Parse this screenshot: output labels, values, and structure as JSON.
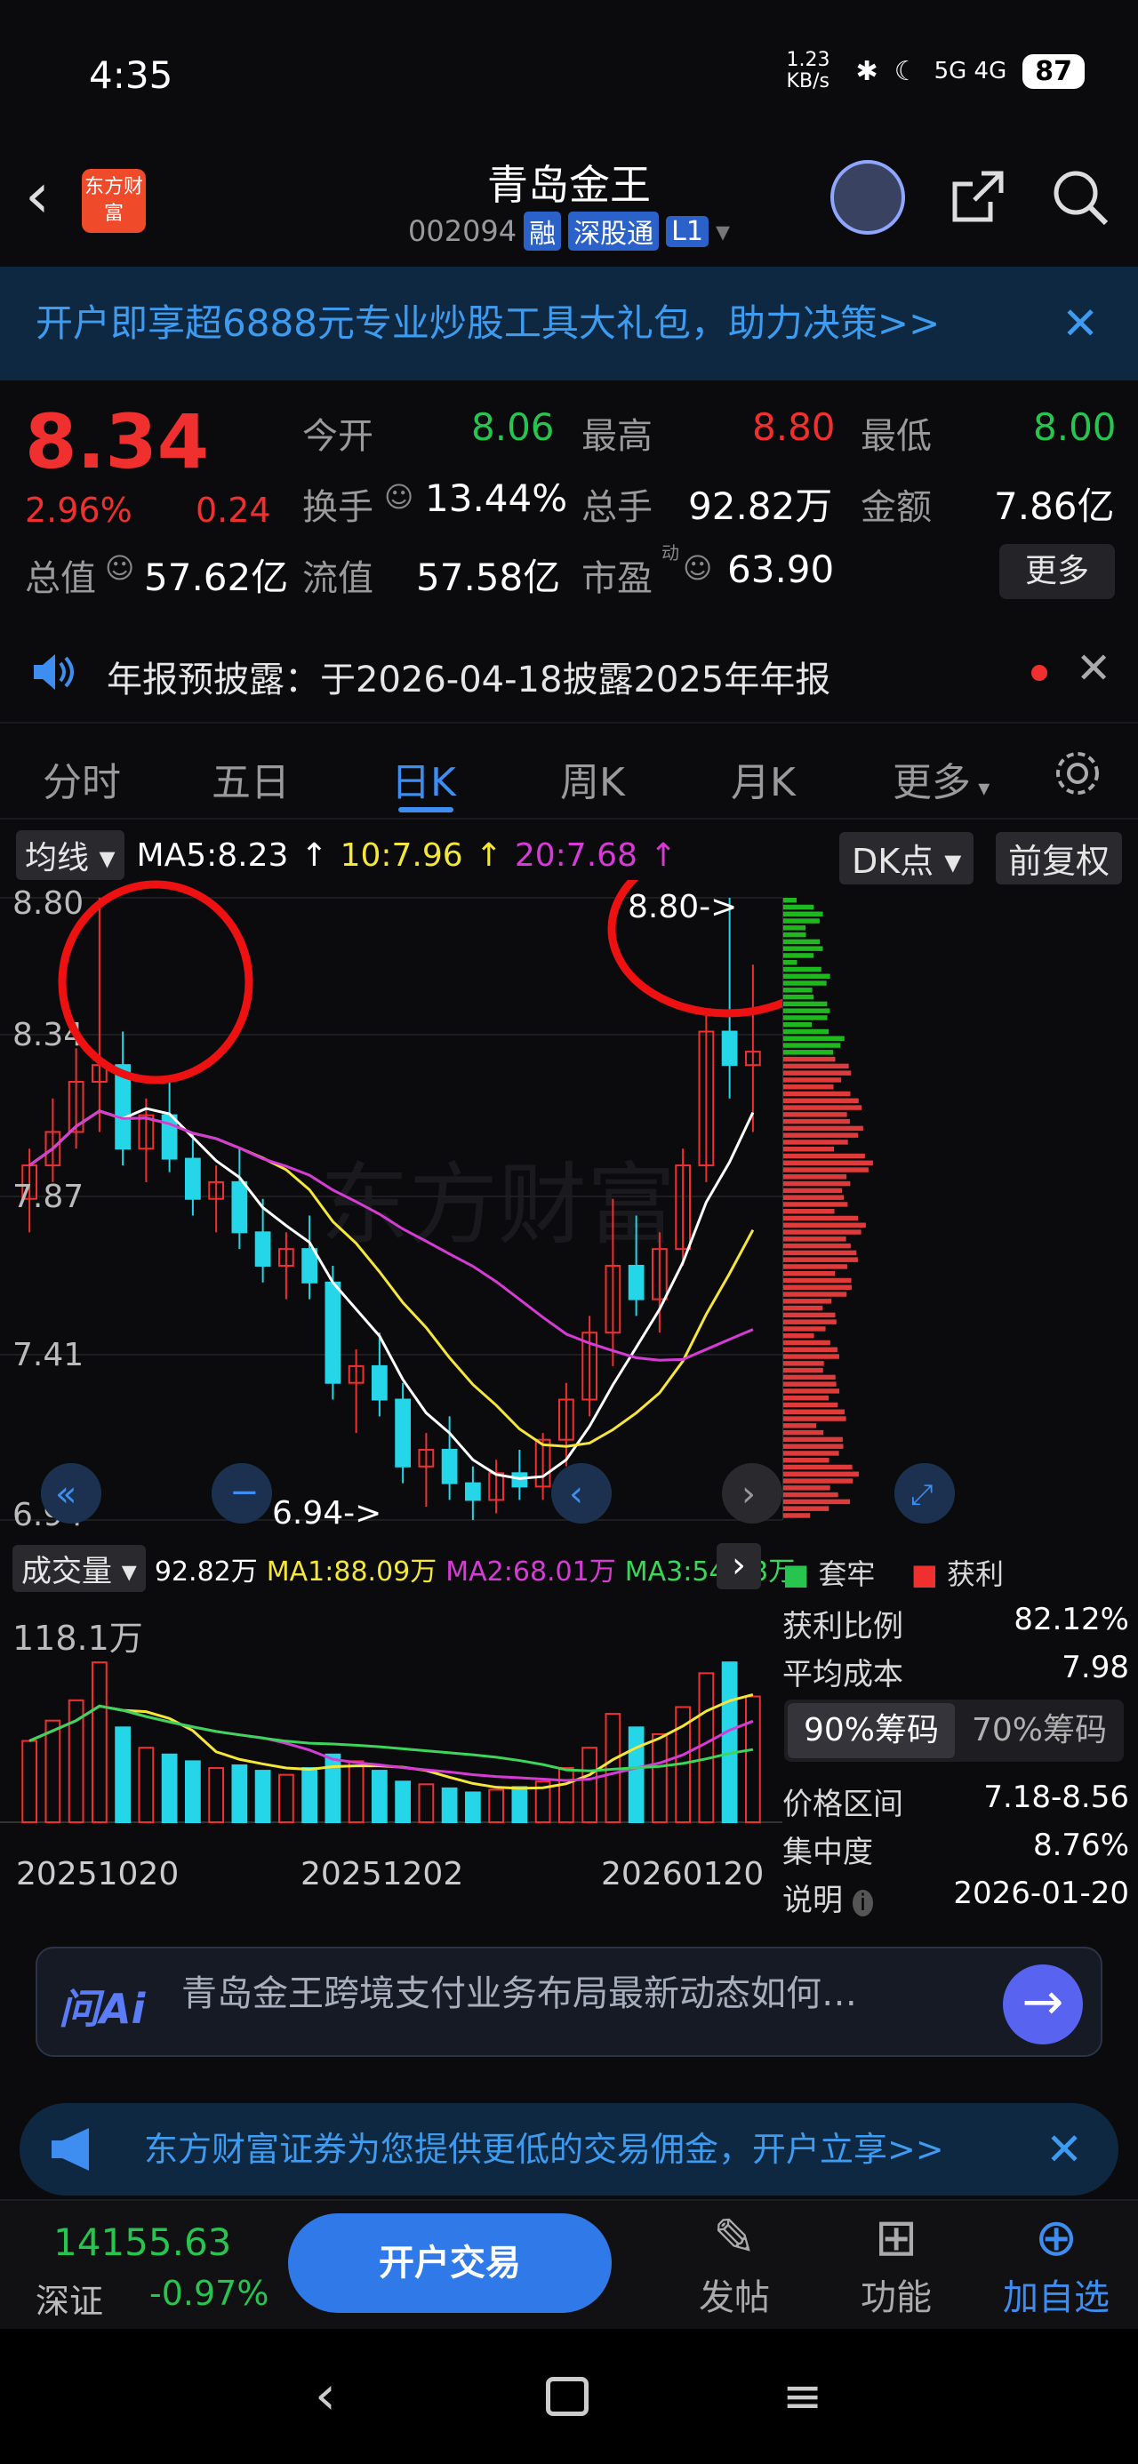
{
  "status": {
    "time": "4:35",
    "net": "1.23 KB/s",
    "signal": "5G 4G",
    "battery": "87"
  },
  "header": {
    "logo": "东方财富",
    "title": "青岛金王",
    "code": "002094",
    "tags": [
      "融",
      "深股通",
      "L1"
    ]
  },
  "banner": {
    "text": "开户即享超6888元专业炒股工具大礼包，助力决策>>"
  },
  "quote": {
    "price": "8.34",
    "pct": "2.96%",
    "change": "0.24",
    "open_label": "今开",
    "open": "8.06",
    "high_label": "最高",
    "high": "8.80",
    "low_label": "最低",
    "low": "8.00",
    "turnover_label": "换手",
    "turnover": "13.44%",
    "volume_label": "总手",
    "volume": "92.82万",
    "amount_label": "金额",
    "amount": "7.86亿",
    "mcap_label": "总值",
    "mcap": "57.62亿",
    "float_label": "流值",
    "float": "57.58亿",
    "pe_label": "市盈",
    "pe_sup": "动",
    "pe": "63.90",
    "more": "更多"
  },
  "notice": {
    "text": "年报预披露：于2026-04-18披露2025年年报"
  },
  "tabs": [
    "分时",
    "五日",
    "日K",
    "周K",
    "月K",
    "更多"
  ],
  "ma": {
    "type": "均线",
    "ma5": "MA5:8.23",
    "ma10": "10:7.96",
    "ma20": "20:7.68",
    "dk": "DK点",
    "fq": "前复权"
  },
  "chart_labels": {
    "y_top": "8.80",
    "y2": "8.34",
    "y3": "7.87",
    "y4": "7.41",
    "y_bottom": "6.94",
    "high_mark": "8.80->",
    "low_mark": "6.94->",
    "watermark": "东方财富"
  },
  "volume": {
    "label": "成交量",
    "v": "92.82万",
    "ma1": "MA1:88.09万",
    "ma2": "MA2:68.01万",
    "ma3": "MA3:54.43万",
    "max": "118.1万",
    "dates": [
      "20251020",
      "20251202",
      "20260120"
    ]
  },
  "chip": {
    "legend_trap": "套牢",
    "legend_profit": "获利",
    "profit_ratio_label": "获利比例",
    "profit_ratio": "82.12%",
    "avg_cost_label": "平均成本",
    "avg_cost": "7.98",
    "seg_a": "90%筹码",
    "seg_b": "70%筹码",
    "range_label": "价格区间",
    "range": "7.18-8.56",
    "conc_label": "集中度",
    "conc": "8.76%",
    "note_label": "说明",
    "note": "2026-01-20"
  },
  "ai": {
    "logo": "问Ai",
    "question": "青岛金王跨境支付业务布局最新动态如何…"
  },
  "ad": {
    "text": "东方财富证券为您提供更低的交易佣金，开户立享>>"
  },
  "bottom": {
    "index_value": "14155.63",
    "index_name": "深证",
    "index_pct": "-0.97%",
    "trade": "开户交易",
    "post": "发帖",
    "func": "功能",
    "add": "加自选"
  },
  "chart_data": {
    "type": "candlestick",
    "ylim": [
      6.94,
      8.8
    ],
    "x_ticks": [
      "20251020",
      "20251202",
      "20260120"
    ],
    "series": [
      {
        "name": "MA5",
        "last": 8.23
      },
      {
        "name": "MA10",
        "last": 7.96
      },
      {
        "name": "MA20",
        "last": 7.68
      }
    ],
    "candles": [
      [
        7.9,
        8.05,
        7.8,
        8.0
      ],
      [
        8.0,
        8.2,
        7.95,
        8.1
      ],
      [
        8.1,
        8.35,
        8.05,
        8.25
      ],
      [
        8.25,
        8.8,
        8.1,
        8.3
      ],
      [
        8.3,
        8.4,
        8.0,
        8.05
      ],
      [
        8.05,
        8.2,
        7.95,
        8.15
      ],
      [
        8.15,
        8.25,
        7.98,
        8.02
      ],
      [
        8.02,
        8.1,
        7.85,
        7.9
      ],
      [
        7.9,
        8.0,
        7.8,
        7.95
      ],
      [
        7.95,
        8.05,
        7.75,
        7.8
      ],
      [
        7.8,
        7.9,
        7.65,
        7.7
      ],
      [
        7.7,
        7.8,
        7.6,
        7.75
      ],
      [
        7.75,
        7.85,
        7.6,
        7.65
      ],
      [
        7.65,
        7.7,
        7.3,
        7.35
      ],
      [
        7.35,
        7.45,
        7.2,
        7.4
      ],
      [
        7.4,
        7.5,
        7.25,
        7.3
      ],
      [
        7.3,
        7.35,
        7.05,
        7.1
      ],
      [
        7.1,
        7.2,
        6.98,
        7.15
      ],
      [
        7.15,
        7.25,
        7.0,
        7.05
      ],
      [
        7.05,
        7.1,
        6.94,
        7.0
      ],
      [
        7.0,
        7.12,
        6.96,
        7.08
      ],
      [
        7.08,
        7.15,
        7.0,
        7.04
      ],
      [
        7.04,
        7.2,
        7.0,
        7.18
      ],
      [
        7.18,
        7.35,
        7.1,
        7.3
      ],
      [
        7.3,
        7.55,
        7.25,
        7.5
      ],
      [
        7.5,
        7.9,
        7.4,
        7.7
      ],
      [
        7.7,
        7.85,
        7.55,
        7.6
      ],
      [
        7.6,
        7.8,
        7.5,
        7.75
      ],
      [
        7.75,
        8.05,
        7.7,
        8.0
      ],
      [
        8.0,
        8.45,
        7.95,
        8.4
      ],
      [
        8.4,
        8.8,
        8.2,
        8.3
      ],
      [
        8.3,
        8.6,
        8.1,
        8.34
      ]
    ],
    "volume": [
      60,
      75,
      90,
      118,
      70,
      55,
      50,
      45,
      40,
      42,
      38,
      35,
      40,
      50,
      45,
      38,
      30,
      28,
      25,
      22,
      24,
      26,
      30,
      40,
      55,
      80,
      70,
      65,
      85,
      110,
      118,
      92.82
    ]
  }
}
